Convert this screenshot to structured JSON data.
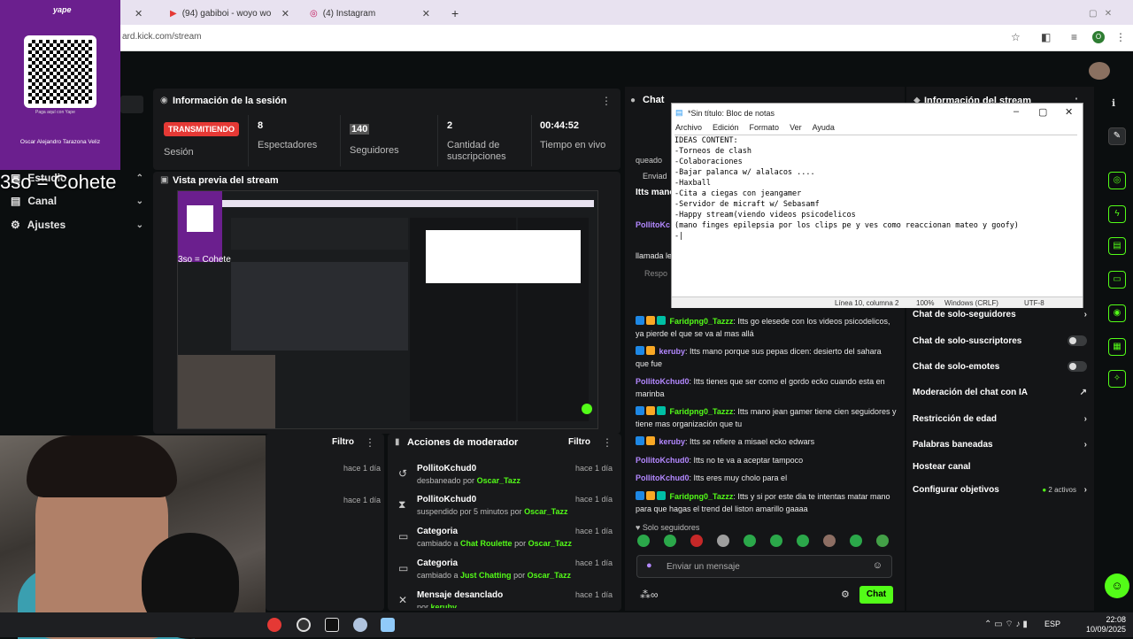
{
  "browser": {
    "tabs": [
      {
        "title": "(94) gabiboi - woyo woyo f",
        "active": false
      },
      {
        "title": "(4) Instagram",
        "active": false
      }
    ],
    "url": "ard.kick.com/stream"
  },
  "qr_panel": {
    "brand": "yape",
    "caption": "Paga aquí con Yape",
    "name": "Oscar Alejandro Tarazona Veliz"
  },
  "overlay_text": "3so = Cohete",
  "sidebar": {
    "items": [
      {
        "label": "Estudio"
      },
      {
        "label": "Canal"
      },
      {
        "label": "Ajustes"
      }
    ]
  },
  "session": {
    "title": "Información de la sesión",
    "live_badge": "TRANSMITIENDO",
    "session_label": "Sesión",
    "viewers": {
      "value": "8",
      "label": "Espectadores"
    },
    "followers": {
      "value": "140",
      "label": "Seguidores"
    },
    "subs": {
      "value": "2",
      "label": "Cantidad de suscripciones"
    },
    "time": {
      "value": "00:44:52",
      "label": "Tiempo en vivo"
    }
  },
  "preview": {
    "title": "Vista previa del stream",
    "inner_overlay": "3so = Cohete"
  },
  "mod_panel_left": {
    "filter": "Filtro",
    "rows": [
      {
        "time": "hace 1 día"
      },
      {
        "time": "hace 1 día"
      }
    ]
  },
  "mod_panel": {
    "title": "Acciones de moderador",
    "filter": "Filtro",
    "rows": [
      {
        "icon": "unban-icon",
        "user": "PollitoKchud0",
        "action": "desbaneado por",
        "by": "Oscar_Tazz",
        "time": "hace 1 día"
      },
      {
        "icon": "hourglass-icon",
        "user": "PollitoKchud0",
        "action": "suspendido por 5 minutos por",
        "by": "Oscar_Tazz",
        "time": "hace 1 día"
      },
      {
        "icon": "category-icon",
        "user": "Categoria",
        "action": "cambiado a",
        "target": "Chat Roulette",
        "by_prefix": "por",
        "by": "Oscar_Tazz",
        "time": "hace 1 día"
      },
      {
        "icon": "category-icon",
        "user": "Categoria",
        "action": "cambiado a",
        "target": "Just Chatting",
        "by_prefix": "por",
        "by": "Oscar_Tazz",
        "time": "hace 1 día"
      },
      {
        "icon": "unpin-icon",
        "user": "Mensaje desanclado",
        "action": "por",
        "by": "keruby",
        "time": "hace 1 día"
      }
    ]
  },
  "chat": {
    "title": "Chat",
    "partial_lines": [
      "queado",
      "Enviad",
      "Itts mano",
      "PollitoKc",
      "llamada le",
      "Respo"
    ],
    "messages": [
      {
        "user": "Faridpng0_Tazzz",
        "badges": true,
        "text": "Itts go elesede con los videos psicodelicos, ya pierde el que se va al mas allá"
      },
      {
        "user": "keruby",
        "badges": true,
        "text": "Itts mano porque sus pepas dicen: desierto del sahara que fue"
      },
      {
        "user": "PollitoKchud0",
        "badges": false,
        "text": "Itts tienes que ser como el gordo ecko cuando esta en marinba"
      },
      {
        "user": "Faridpng0_Tazzz",
        "badges": true,
        "text": "Itts mano jean gamer tiene cien seguidores y tiene mas organización que tu"
      },
      {
        "user": "keruby",
        "badges": true,
        "text": "Itts se refiere a misael ecko edwars"
      },
      {
        "user": "PollitoKchud0",
        "badges": false,
        "text": "Itts no te va a aceptar tampoco"
      },
      {
        "user": "PollitoKchud0",
        "badges": false,
        "text": "Itts eres muy cholo para el"
      },
      {
        "user": "Faridpng0_Tazzz",
        "badges": true,
        "text": "Itts y si por este dia te intentas matar mano para que hagas el trend del liston amarillo gaaaa"
      }
    ],
    "followers_only": "Solo seguidores",
    "input_placeholder": "Enviar un mensaje",
    "send_button": "Chat"
  },
  "stream_info": {
    "title": "Información del stream",
    "settings": [
      {
        "label": "Chat de solo-seguidores",
        "control": "chevron"
      },
      {
        "label": "Chat de solo-suscriptores",
        "control": "toggle"
      },
      {
        "label": "Chat de solo-emotes",
        "control": "toggle"
      },
      {
        "label": "Moderación del chat con IA",
        "control": "external"
      },
      {
        "label": "Restricción de edad",
        "control": "chevron"
      },
      {
        "label": "Palabras baneadas",
        "control": "chevron"
      },
      {
        "label": "Hostear canal",
        "control": "none"
      },
      {
        "label": "Configurar objetivos",
        "control": "chevron",
        "extra": "2 activos"
      }
    ]
  },
  "notepad": {
    "title": "*Sin título: Bloc de notas",
    "menu": [
      "Archivo",
      "Edición",
      "Formato",
      "Ver",
      "Ayuda"
    ],
    "content": "IDEAS CONTENT:\n-Torneos de clash\n-Colaboraciones\n-Bajar palanca w/ alalacos ....\n-Haxball\n-Cita a ciegas con jeangamer\n-Servidor de micraft w/ Sebasamf\n-Happy stream(viendo videos psicodelicos\n(mano finges epilepsia por los clips pe y ves como reaccionan mateo y goofy)\n-|",
    "status": {
      "position": "Línea 10, columna 2",
      "zoom": "100%",
      "eol": "Windows (CRLF)",
      "encoding": "UTF-8"
    }
  },
  "taskbar": {
    "lang": "ESP",
    "time": "22:08",
    "date": "10/09/2025"
  },
  "colors": {
    "accent": "#53fc18",
    "live": "#e53935",
    "yape": "#6b1f8e"
  }
}
